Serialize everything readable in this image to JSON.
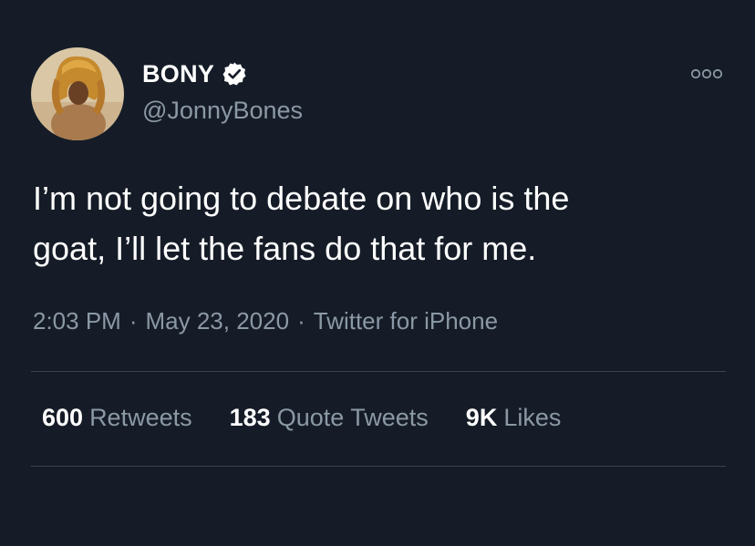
{
  "author": {
    "display_name": "BONY",
    "handle": "@JonnyBones",
    "verified": true,
    "verified_icon": "verified-badge-icon",
    "avatar_icon": "lion-headdress-avatar"
  },
  "tweet": {
    "text": "I’m not going to debate on who is the\ngoat, I’ll let the fans do that for me.",
    "time": "2:03 PM",
    "separator": "·",
    "date": "May 23, 2020",
    "source": "Twitter for iPhone"
  },
  "stats": {
    "retweets": {
      "count": "600",
      "label": "Retweets"
    },
    "quote_tweets": {
      "count": "183",
      "label": "Quote Tweets"
    },
    "likes": {
      "count": "9K",
      "label": "Likes"
    }
  },
  "menu_icon": "more-options-icon",
  "colors": {
    "background": "#151c27",
    "primary_text": "#ffffff",
    "secondary_text": "#8b98a5",
    "divider": "#38444d"
  }
}
